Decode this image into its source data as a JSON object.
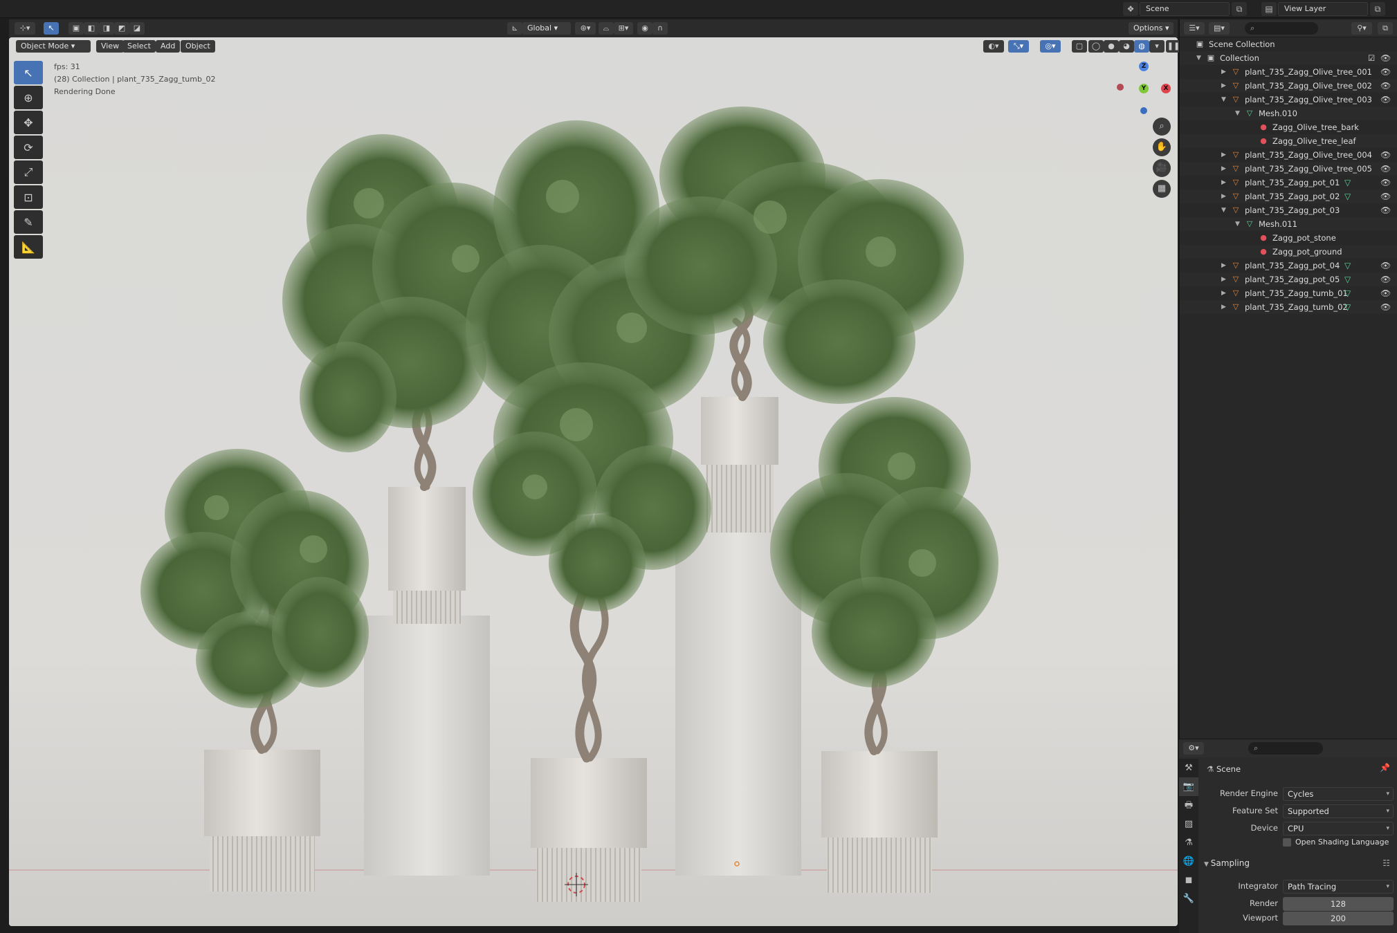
{
  "topbar": {
    "scene_label": "Scene",
    "view_layer_label": "View Layer"
  },
  "viewport_header": {
    "mode_label": "Object Mode",
    "menus": [
      "View",
      "Select",
      "Add",
      "Object"
    ],
    "orientation_label": "Global",
    "options_label": "Options"
  },
  "viewport_overlay": {
    "fps_text": "fps: 31",
    "selection_text": "(28) Collection | plant_735_Zagg_tumb_02",
    "status_text": "Rendering Done"
  },
  "gizmo": {
    "z_label": "Z",
    "y_label": "Y",
    "x_label": "X"
  },
  "outliner": {
    "root_label": "Scene Collection",
    "collection_label": "Collection",
    "items": [
      {
        "label": "plant_735_Zagg_Olive_tree_001",
        "type": "object",
        "indent": 2,
        "expanded": false,
        "eye": true,
        "mesh_badge": false
      },
      {
        "label": "plant_735_Zagg_Olive_tree_002",
        "type": "object",
        "indent": 2,
        "expanded": false,
        "eye": true,
        "mesh_badge": false
      },
      {
        "label": "plant_735_Zagg_Olive_tree_003",
        "type": "object",
        "indent": 2,
        "expanded": true,
        "eye": true,
        "mesh_badge": false
      },
      {
        "label": "Mesh.010",
        "type": "mesh",
        "indent": 3,
        "expanded": true,
        "eye": false,
        "mesh_badge": false
      },
      {
        "label": "Zagg_Olive_tree_bark",
        "type": "material",
        "indent": 4,
        "expanded": null,
        "eye": false,
        "mesh_badge": false
      },
      {
        "label": "Zagg_Olive_tree_leaf",
        "type": "material",
        "indent": 4,
        "expanded": null,
        "eye": false,
        "mesh_badge": false
      },
      {
        "label": "plant_735_Zagg_Olive_tree_004",
        "type": "object",
        "indent": 2,
        "expanded": false,
        "eye": true,
        "mesh_badge": false
      },
      {
        "label": "plant_735_Zagg_Olive_tree_005",
        "type": "object",
        "indent": 2,
        "expanded": false,
        "eye": true,
        "mesh_badge": false
      },
      {
        "label": "plant_735_Zagg_pot_01",
        "type": "object",
        "indent": 2,
        "expanded": false,
        "eye": true,
        "mesh_badge": true
      },
      {
        "label": "plant_735_Zagg_pot_02",
        "type": "object",
        "indent": 2,
        "expanded": false,
        "eye": true,
        "mesh_badge": true
      },
      {
        "label": "plant_735_Zagg_pot_03",
        "type": "object",
        "indent": 2,
        "expanded": true,
        "eye": true,
        "mesh_badge": false
      },
      {
        "label": "Mesh.011",
        "type": "mesh",
        "indent": 3,
        "expanded": true,
        "eye": false,
        "mesh_badge": false
      },
      {
        "label": "Zagg_pot_stone",
        "type": "material",
        "indent": 4,
        "expanded": null,
        "eye": false,
        "mesh_badge": false
      },
      {
        "label": "Zagg_pot_ground",
        "type": "material",
        "indent": 4,
        "expanded": null,
        "eye": false,
        "mesh_badge": false
      },
      {
        "label": "plant_735_Zagg_pot_04",
        "type": "object",
        "indent": 2,
        "expanded": false,
        "eye": true,
        "mesh_badge": true
      },
      {
        "label": "plant_735_Zagg_pot_05",
        "type": "object",
        "indent": 2,
        "expanded": false,
        "eye": true,
        "mesh_badge": true
      },
      {
        "label": "plant_735_Zagg_tumb_01",
        "type": "object",
        "indent": 2,
        "expanded": false,
        "eye": true,
        "mesh_badge": true
      },
      {
        "label": "plant_735_Zagg_tumb_02",
        "type": "object",
        "indent": 2,
        "expanded": false,
        "eye": true,
        "mesh_badge": true
      }
    ]
  },
  "properties": {
    "context_label": "Scene",
    "render_engine_label": "Render Engine",
    "render_engine_value": "Cycles",
    "feature_set_label": "Feature Set",
    "feature_set_value": "Supported",
    "device_label": "Device",
    "device_value": "CPU",
    "osl_label": "Open Shading Language",
    "sampling_label": "Sampling",
    "integrator_label": "Integrator",
    "integrator_value": "Path Tracing",
    "render_label": "Render",
    "render_value": "128",
    "viewport_label": "Viewport",
    "viewport_value": "200"
  },
  "colors": {
    "accent": "#4772b3",
    "object_icon": "#e4883b",
    "mesh_icon": "#5fd09a",
    "material_icon": "#e0525a",
    "viewport_bg": "#dcdbd8",
    "foliage": "#4d6b3a"
  }
}
